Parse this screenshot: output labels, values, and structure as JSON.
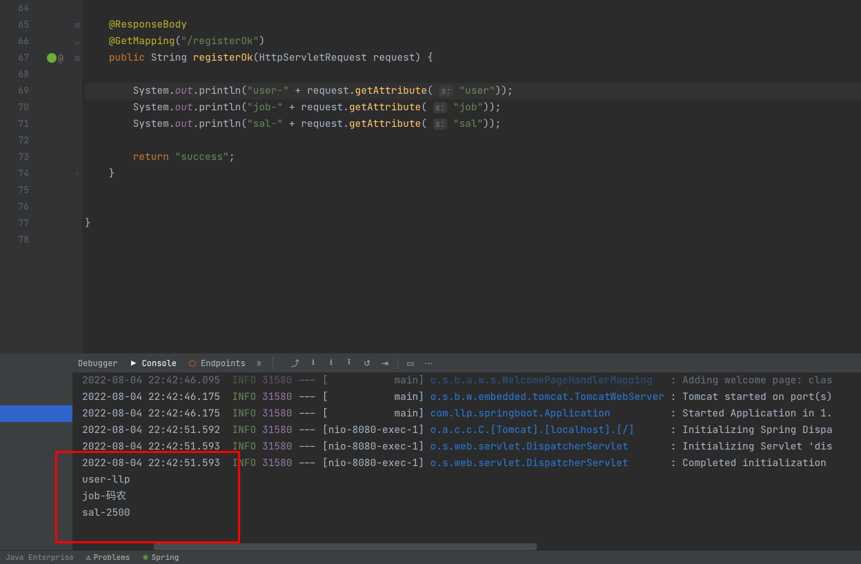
{
  "gutter": [
    "64",
    "65",
    "66",
    "67",
    "68",
    "69",
    "70",
    "71",
    "72",
    "73",
    "74",
    "75",
    "76",
    "77",
    "78"
  ],
  "code": {
    "line64": "",
    "annotation1": "@ResponseBody",
    "annotation2pre": "@GetMapping",
    "paren1": "(",
    "mapping": "\"/registerOk\"",
    "paren2": ")",
    "kw_public": "public ",
    "type_string": "String ",
    "method_name": "registerOk",
    "sig_open": "(",
    "param_type": "HttpServletRequest ",
    "param_name": "request",
    "sig_close": ") {",
    "out": "out",
    "println": ".println(",
    "sys": "System.",
    "str_user": "\"user-\"",
    "str_job": "\"job-\"",
    "str_sal": "\"sal-\"",
    "plus": " + request.",
    "getattr": "getAttribute",
    "open": "( ",
    "hint": "s:",
    " ": " ",
    "val_user": "\"user\"",
    "val_job": "\"job\"",
    "val_sal": "\"sal\"",
    "close": "));",
    "kw_return": "return ",
    "str_success": "\"success\"",
    "semi": ";",
    "brace_close": "}",
    "end_brace": "}"
  },
  "panel_tabs": {
    "debugger": "Debugger",
    "console": "Console",
    "endpoints": "Endpoints"
  },
  "logs": [
    {
      "ts": "2022-08-04 22:42:46.095",
      "lvl": "INFO",
      "pid": "31580",
      "dash": " --- [",
      "thread": "           main",
      "br": "] ",
      "logger": "o.s.b.a.w.s.WelcomePageHandlerMapping   ",
      "msg": ": Adding welcome page: clas"
    },
    {
      "ts": "2022-08-04 22:42:46.175",
      "lvl": "INFO",
      "pid": "31580",
      "dash": " --- [",
      "thread": "           main",
      "br": "] ",
      "logger": "o.s.b.w.embedded.tomcat.TomcatWebServer ",
      "msg": ": Tomcat started on port(s)"
    },
    {
      "ts": "2022-08-04 22:42:46.175",
      "lvl": "INFO",
      "pid": "31580",
      "dash": " --- [",
      "thread": "           main",
      "br": "] ",
      "logger": "com.llp.springboot.Application          ",
      "msg": ": Started Application in 1."
    },
    {
      "ts": "2022-08-04 22:42:51.592",
      "lvl": "INFO",
      "pid": "31580",
      "dash": " --- [",
      "thread": "nio-8080-exec-1",
      "br": "] ",
      "logger": "o.a.c.c.C.[Tomcat].[localhost].[/]      ",
      "msg": ": Initializing Spring Dispa"
    },
    {
      "ts": "2022-08-04 22:42:51.593",
      "lvl": "INFO",
      "pid": "31580",
      "dash": " --- [",
      "thread": "nio-8080-exec-1",
      "br": "] ",
      "logger": "o.s.web.servlet.DispatcherServlet       ",
      "msg": ": Initializing Servlet 'dis"
    },
    {
      "ts": "2022-08-04 22:42:51.593",
      "lvl": "INFO",
      "pid": "31580",
      "dash": " --- [",
      "thread": "nio-8080-exec-1",
      "br": "] ",
      "logger": "o.s.web.servlet.DispatcherServlet       ",
      "msg": ": Completed initialization "
    }
  ],
  "output": {
    "l1": "user-llp",
    "l2": "job-码农",
    "l3": "sal-2500"
  },
  "status": {
    "left": "Java Enterprise",
    "problems": "Problems",
    "spring": "Spring"
  }
}
